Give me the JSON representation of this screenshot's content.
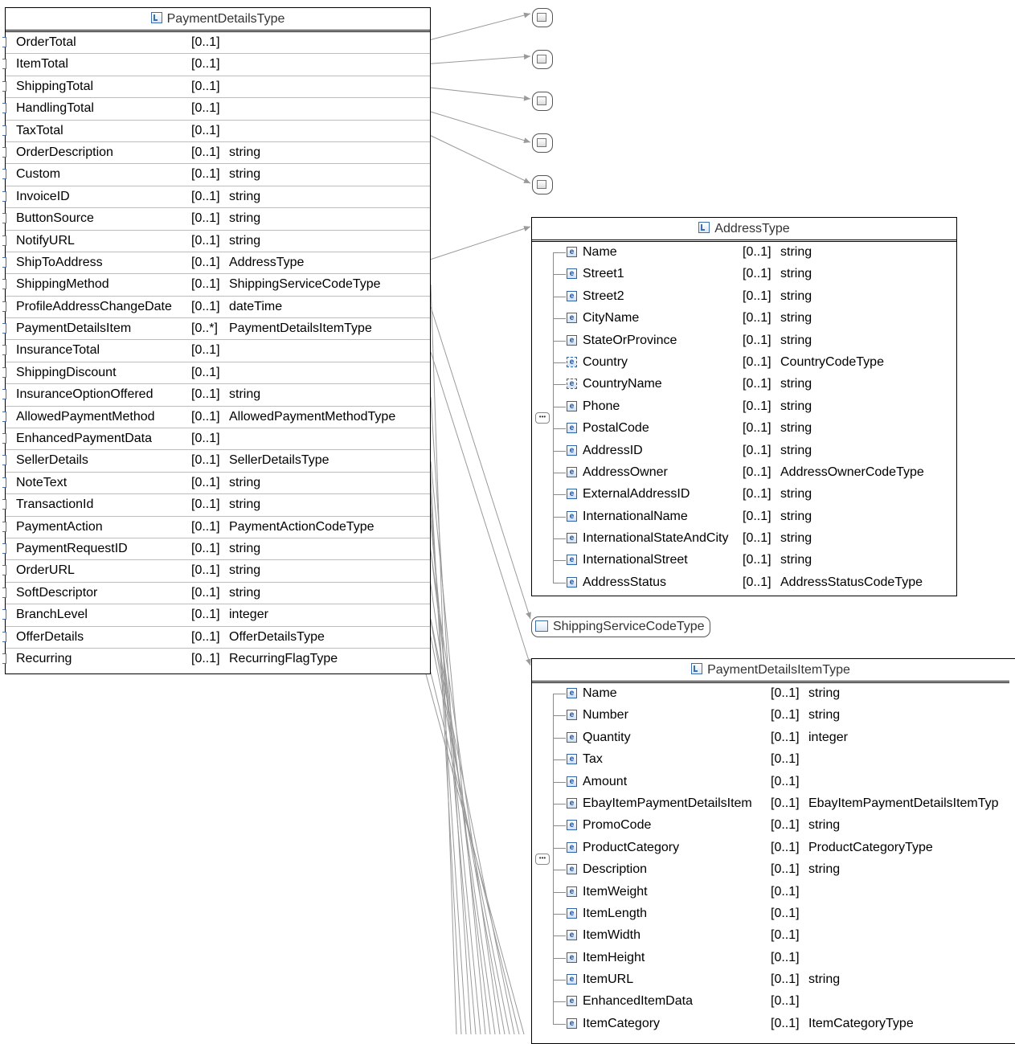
{
  "payment_details_type": {
    "title": "PaymentDetailsType",
    "rows": [
      {
        "name": "OrderTotal",
        "card": "[0..1]",
        "type": ""
      },
      {
        "name": "ItemTotal",
        "card": "[0..1]",
        "type": ""
      },
      {
        "name": "ShippingTotal",
        "card": "[0..1]",
        "type": ""
      },
      {
        "name": "HandlingTotal",
        "card": "[0..1]",
        "type": ""
      },
      {
        "name": "TaxTotal",
        "card": "[0..1]",
        "type": ""
      },
      {
        "name": "OrderDescription",
        "card": "[0..1]",
        "type": "string"
      },
      {
        "name": "Custom",
        "card": "[0..1]",
        "type": "string"
      },
      {
        "name": "InvoiceID",
        "card": "[0..1]",
        "type": "string"
      },
      {
        "name": "ButtonSource",
        "card": "[0..1]",
        "type": "string"
      },
      {
        "name": "NotifyURL",
        "card": "[0..1]",
        "type": "string"
      },
      {
        "name": "ShipToAddress",
        "card": "[0..1]",
        "type": "AddressType"
      },
      {
        "name": "ShippingMethod",
        "card": "[0..1]",
        "type": "ShippingServiceCodeType"
      },
      {
        "name": "ProfileAddressChangeDate",
        "card": "[0..1]",
        "type": "dateTime"
      },
      {
        "name": "PaymentDetailsItem",
        "card": "[0..*]",
        "type": "PaymentDetailsItemType"
      },
      {
        "name": "InsuranceTotal",
        "card": "[0..1]",
        "type": ""
      },
      {
        "name": "ShippingDiscount",
        "card": "[0..1]",
        "type": ""
      },
      {
        "name": "InsuranceOptionOffered",
        "card": "[0..1]",
        "type": "string"
      },
      {
        "name": "AllowedPaymentMethod",
        "card": "[0..1]",
        "type": "AllowedPaymentMethodType"
      },
      {
        "name": "EnhancedPaymentData",
        "card": "[0..1]",
        "type": ""
      },
      {
        "name": "SellerDetails",
        "card": "[0..1]",
        "type": "SellerDetailsType"
      },
      {
        "name": "NoteText",
        "card": "[0..1]",
        "type": "string"
      },
      {
        "name": "TransactionId",
        "card": "[0..1]",
        "type": "string"
      },
      {
        "name": "PaymentAction",
        "card": "[0..1]",
        "type": "PaymentActionCodeType"
      },
      {
        "name": "PaymentRequestID",
        "card": "[0..1]",
        "type": "string"
      },
      {
        "name": "OrderURL",
        "card": "[0..1]",
        "type": "string"
      },
      {
        "name": "SoftDescriptor",
        "card": "[0..1]",
        "type": "string"
      },
      {
        "name": "BranchLevel",
        "card": "[0..1]",
        "type": "integer"
      },
      {
        "name": "OfferDetails",
        "card": "[0..1]",
        "type": "OfferDetailsType"
      },
      {
        "name": "Recurring",
        "card": "[0..1]",
        "type": "RecurringFlagType"
      }
    ]
  },
  "address_type": {
    "title": "AddressType",
    "rows": [
      {
        "name": "Name",
        "card": "[0..1]",
        "type": "string",
        "kind": "element"
      },
      {
        "name": "Street1",
        "card": "[0..1]",
        "type": "string",
        "kind": "element"
      },
      {
        "name": "Street2",
        "card": "[0..1]",
        "type": "string",
        "kind": "element"
      },
      {
        "name": "CityName",
        "card": "[0..1]",
        "type": "string",
        "kind": "element"
      },
      {
        "name": "StateOrProvince",
        "card": "[0..1]",
        "type": "string",
        "kind": "element"
      },
      {
        "name": "Country",
        "card": "[0..1]",
        "type": "CountryCodeType",
        "kind": "ref"
      },
      {
        "name": "CountryName",
        "card": "[0..1]",
        "type": "string",
        "kind": "ref"
      },
      {
        "name": "Phone",
        "card": "[0..1]",
        "type": "string",
        "kind": "element"
      },
      {
        "name": "PostalCode",
        "card": "[0..1]",
        "type": "string",
        "kind": "element"
      },
      {
        "name": "AddressID",
        "card": "[0..1]",
        "type": "string",
        "kind": "element"
      },
      {
        "name": "AddressOwner",
        "card": "[0..1]",
        "type": "AddressOwnerCodeType",
        "kind": "element"
      },
      {
        "name": "ExternalAddressID",
        "card": "[0..1]",
        "type": "string",
        "kind": "element"
      },
      {
        "name": "InternationalName",
        "card": "[0..1]",
        "type": "string",
        "kind": "element"
      },
      {
        "name": "InternationalStateAndCity",
        "card": "[0..1]",
        "type": "string",
        "kind": "element"
      },
      {
        "name": "InternationalStreet",
        "card": "[0..1]",
        "type": "string",
        "kind": "element"
      },
      {
        "name": "AddressStatus",
        "card": "[0..1]",
        "type": "AddressStatusCodeType",
        "kind": "element"
      }
    ]
  },
  "shipping_service_code_type": {
    "title": "ShippingServiceCodeType"
  },
  "payment_details_item_type": {
    "title": "PaymentDetailsItemType",
    "rows": [
      {
        "name": "Name",
        "card": "[0..1]",
        "type": "string"
      },
      {
        "name": "Number",
        "card": "[0..1]",
        "type": "string"
      },
      {
        "name": "Quantity",
        "card": "[0..1]",
        "type": "integer"
      },
      {
        "name": "Tax",
        "card": "[0..1]",
        "type": ""
      },
      {
        "name": "Amount",
        "card": "[0..1]",
        "type": ""
      },
      {
        "name": "EbayItemPaymentDetailsItem",
        "card": "[0..1]",
        "type": "EbayItemPaymentDetailsItemTyp"
      },
      {
        "name": "PromoCode",
        "card": "[0..1]",
        "type": "string"
      },
      {
        "name": "ProductCategory",
        "card": "[0..1]",
        "type": "ProductCategoryType"
      },
      {
        "name": "Description",
        "card": "[0..1]",
        "type": "string"
      },
      {
        "name": "ItemWeight",
        "card": "[0..1]",
        "type": ""
      },
      {
        "name": "ItemLength",
        "card": "[0..1]",
        "type": ""
      },
      {
        "name": "ItemWidth",
        "card": "[0..1]",
        "type": ""
      },
      {
        "name": "ItemHeight",
        "card": "[0..1]",
        "type": ""
      },
      {
        "name": "ItemURL",
        "card": "[0..1]",
        "type": "string"
      },
      {
        "name": "EnhancedItemData",
        "card": "[0..1]",
        "type": ""
      },
      {
        "name": "ItemCategory",
        "card": "[0..1]",
        "type": "ItemCategoryType"
      }
    ]
  },
  "icons": {
    "element": "element-icon",
    "element_ref": "element-reference-icon",
    "complex_type": "complex-type-icon",
    "simple_type": "simple-type-icon",
    "sequence": "sequence-icon"
  },
  "colors": {
    "border": "#000000",
    "row_divider": "#bdbdbd",
    "icon_blue": "#2d63a8",
    "connector": "#9a9a9a"
  }
}
